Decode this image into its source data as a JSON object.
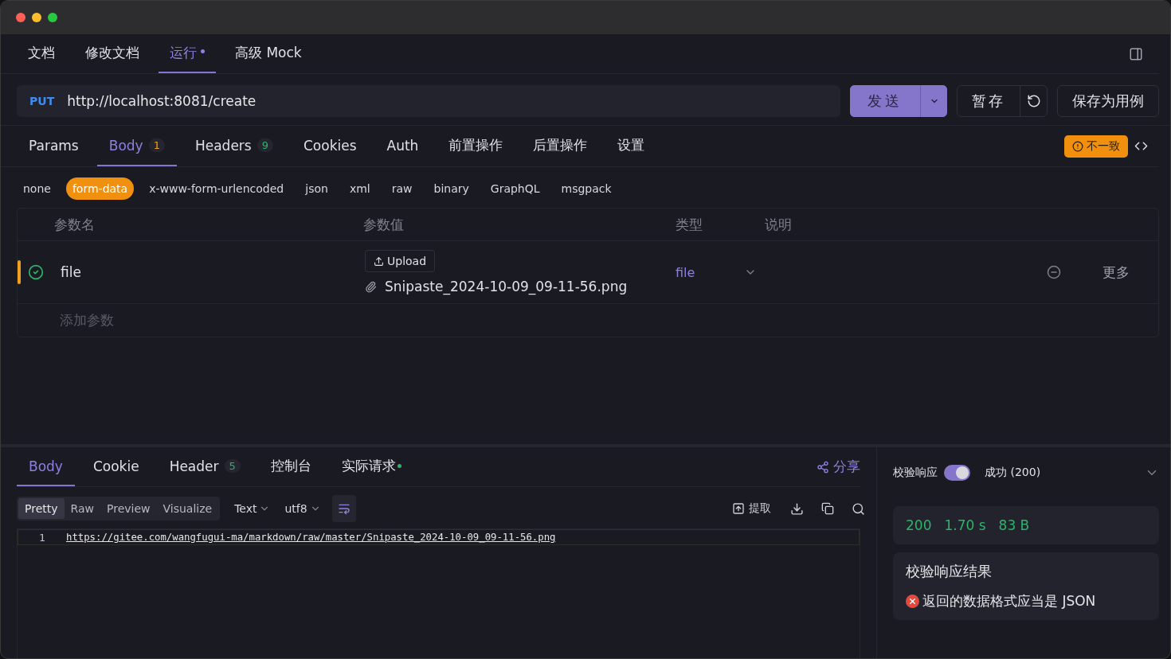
{
  "top_tabs": [
    {
      "label": "文档",
      "selected": false,
      "dot": false
    },
    {
      "label": "修改文档",
      "selected": false,
      "dot": false
    },
    {
      "label": "运行",
      "selected": true,
      "dot": true
    },
    {
      "label": "高级 Mock",
      "selected": false,
      "dot": false
    }
  ],
  "request": {
    "method": "PUT",
    "url": "http://localhost:8081/create",
    "send": "发送",
    "save_draft": "暂存",
    "save_case": "保存为用例"
  },
  "request_tabs": [
    {
      "label": "Params",
      "selected": false
    },
    {
      "label": "Body",
      "count": "1",
      "selected": true
    },
    {
      "label": "Headers",
      "count": "9",
      "selected": false
    },
    {
      "label": "Cookies",
      "selected": false
    },
    {
      "label": "Auth",
      "selected": false
    },
    {
      "label": "前置操作",
      "selected": false
    },
    {
      "label": "后置操作",
      "selected": false
    },
    {
      "label": "设置",
      "selected": false
    }
  ],
  "mismatch_badge": "不一致",
  "body_types": [
    {
      "label": "none",
      "selected": false
    },
    {
      "label": "form-data",
      "selected": true
    },
    {
      "label": "x-www-form-urlencoded",
      "selected": false
    },
    {
      "label": "json",
      "selected": false
    },
    {
      "label": "xml",
      "selected": false
    },
    {
      "label": "raw",
      "selected": false
    },
    {
      "label": "binary",
      "selected": false
    },
    {
      "label": "GraphQL",
      "selected": false
    },
    {
      "label": "msgpack",
      "selected": false
    }
  ],
  "params_table": {
    "columns": [
      "参数名",
      "参数值",
      "类型",
      "说明"
    ],
    "rows": [
      {
        "name": "file",
        "checked": true,
        "upload": "Upload",
        "file_name": "Snipaste_2024-10-09_09-11-56.png",
        "type": "file",
        "more": "更多"
      }
    ],
    "add_placeholder": "添加参数"
  },
  "response": {
    "tabs": [
      {
        "label": "Body",
        "selected": true,
        "dot": false
      },
      {
        "label": "Cookie",
        "selected": false,
        "dot": false
      },
      {
        "label": "Header",
        "count": "5",
        "selected": false,
        "dot": false
      },
      {
        "label": "控制台",
        "selected": false,
        "dot": false
      },
      {
        "label": "实际请求",
        "selected": false,
        "dot": true
      }
    ],
    "share": "分享",
    "view_modes": [
      {
        "label": "Pretty",
        "selected": true
      },
      {
        "label": "Raw",
        "selected": false
      },
      {
        "label": "Preview",
        "selected": false
      },
      {
        "label": "Visualize",
        "selected": false
      }
    ],
    "format": "Text",
    "encoding": "utf8",
    "extract": "提取",
    "lines": [
      {
        "number": "1",
        "text": "https://gitee.com/wangfugui-ma/markdown/raw/master/Snipaste_2024-10-09_09-11-56.png"
      }
    ]
  },
  "validation": {
    "label": "校验响应",
    "on": true,
    "status": "成功 (200)",
    "metrics": [
      "200",
      "1.70 s",
      "83 B"
    ],
    "result_title": "校验响应结果",
    "result_message": "返回的数据格式应当是 JSON"
  }
}
